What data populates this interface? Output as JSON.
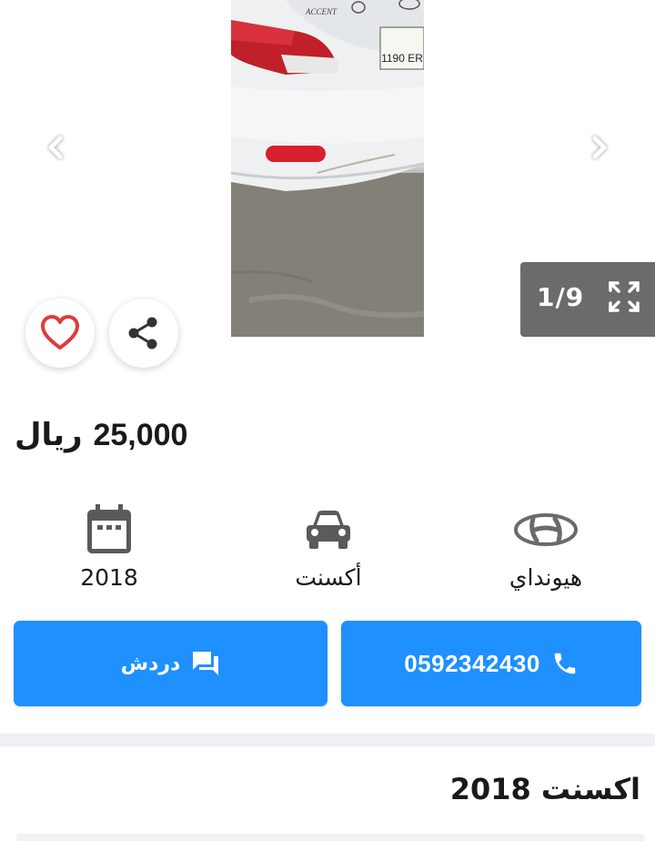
{
  "gallery": {
    "counter": "1/9",
    "plate_text": "1190 ER",
    "badge_text": "ACCENT"
  },
  "listing": {
    "price": "25,000",
    "currency": "ريال",
    "title": "اكسنت 2018"
  },
  "specs": {
    "year": "2018",
    "model": "أكسنت",
    "make": "هيونداي"
  },
  "actions": {
    "chat_label": "دردش",
    "phone": "0592342430"
  },
  "colors": {
    "accent": "#1e90ff",
    "heart": "#e03a3a",
    "counter_bg": "#6b6b6b"
  },
  "icons": {
    "prev": "chevron-left-icon",
    "next": "chevron-right-icon",
    "fullscreen": "fullscreen-icon",
    "favorite": "heart-icon",
    "share": "share-icon",
    "year": "calendar-icon",
    "model": "car-icon",
    "make": "hyundai-logo-icon",
    "chat": "chat-icon",
    "call": "phone-icon"
  }
}
